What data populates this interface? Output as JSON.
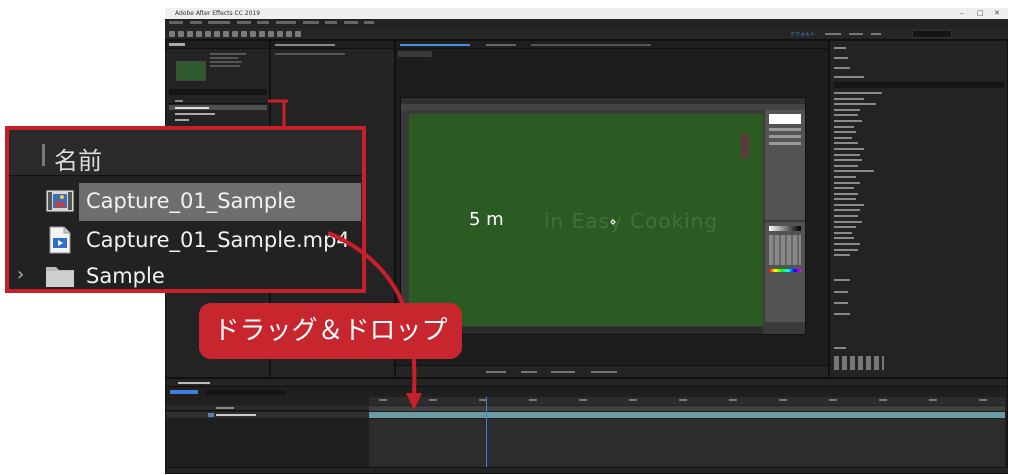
{
  "window": {
    "title": "Adobe After Effects CC 2019",
    "controls": [
      "–",
      "□",
      "✕"
    ]
  },
  "workspace_tabs": {
    "active": "デフォルト"
  },
  "project": {
    "header_name": "名前",
    "items": [
      {
        "name": "Capture_01_Sample",
        "type": "composition"
      },
      {
        "name": "Capture_01_Sample.mp4",
        "type": "video"
      },
      {
        "name": "Sample",
        "type": "folder"
      }
    ]
  },
  "composition": {
    "overlay_text": "5 m",
    "watermark": "in Easy Cooking"
  },
  "zoom": {
    "header_label": "名前",
    "rows": [
      {
        "label": "Capture_01_Sample",
        "icon": "composition-icon",
        "selected": true
      },
      {
        "label": "Capture_01_Sample.mp4",
        "icon": "video-file-icon",
        "selected": false
      },
      {
        "label": "Sample",
        "icon": "folder-icon",
        "selected": false,
        "expandable": true
      }
    ]
  },
  "callout": {
    "text": "ドラッグ＆ドロップ"
  },
  "colors": {
    "callout": "#c8262f",
    "highlight_border": "#c8202a",
    "green_screen": "#2b5b22",
    "playhead": "#3d7fe0",
    "selected_row": "#6e6e6e"
  }
}
